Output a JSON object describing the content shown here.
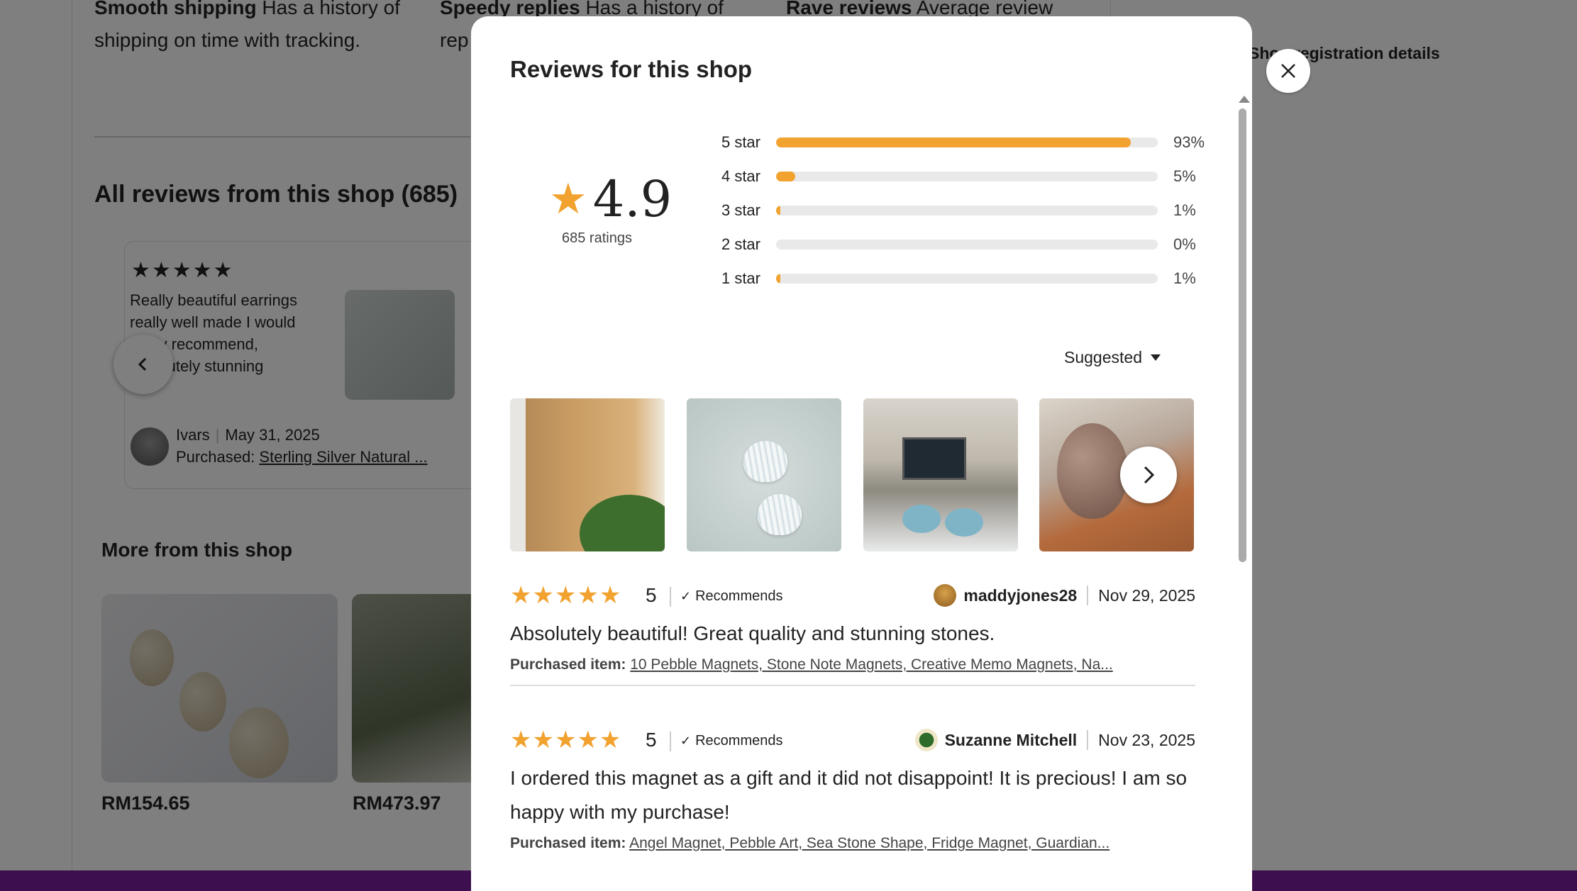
{
  "background": {
    "highlights": [
      {
        "title": "Smooth shipping",
        "text": "Has a history of shipping on time with tracking."
      },
      {
        "title": "Speedy replies",
        "text": "Has a history of rep"
      },
      {
        "title": "Rave reviews",
        "text": "Average review"
      }
    ],
    "right_link": "Shop registration details",
    "all_reviews_title": "All reviews from this shop (685)",
    "card": {
      "stars": "★★★★★",
      "text": "Really beautiful earrings really well made I would really recommend, absolutely stunning",
      "reviewer": "Ivars",
      "date": "May 31, 2025",
      "purchased_label": "Purchased:",
      "purchased_item": "Sterling Silver Natural ..."
    },
    "more_from_shop": "More from this shop",
    "products": [
      {
        "price": "RM154.65"
      },
      {
        "price": "RM473.97"
      }
    ]
  },
  "modal": {
    "title": "Reviews for this shop",
    "rating": "4.9",
    "ratings_count": "685 ratings",
    "distribution": [
      {
        "label": "5 star",
        "pct": "93%",
        "value": 0.93
      },
      {
        "label": "4 star",
        "pct": "5%",
        "value": 0.05
      },
      {
        "label": "3 star",
        "pct": "1%",
        "value": 0.01
      },
      {
        "label": "2 star",
        "pct": "0%",
        "value": 0.0
      },
      {
        "label": "1 star",
        "pct": "1%",
        "value": 0.01
      }
    ],
    "sort_label": "Suggested",
    "reviews": [
      {
        "stars": "★★★★★",
        "score": "5",
        "recommends": "Recommends",
        "user": "maddyjones28",
        "date": "Nov 29, 2025",
        "text": "Absolutely beautiful! Great quality and stunning stones.",
        "purchased_label": "Purchased item:",
        "purchased_item": "10 Pebble Magnets, Stone Note Magnets, Creative Memo Magnets, Na..."
      },
      {
        "stars": "★★★★★",
        "score": "5",
        "recommends": "Recommends",
        "user": "Suzanne Mitchell",
        "date": "Nov 23, 2025",
        "text": "I ordered this magnet as a gift and it did not disappoint! It is precious! I am so happy with my purchase!",
        "purchased_label": "Purchased item:",
        "purchased_item": "Angel Magnet, Pebble Art, Sea Stone Shape, Fridge Magnet, Guardian..."
      }
    ]
  },
  "colors": {
    "star": "#f1a22f",
    "bar_track": "#e9e9e9",
    "bottom_bar": "#3d0f4f"
  }
}
